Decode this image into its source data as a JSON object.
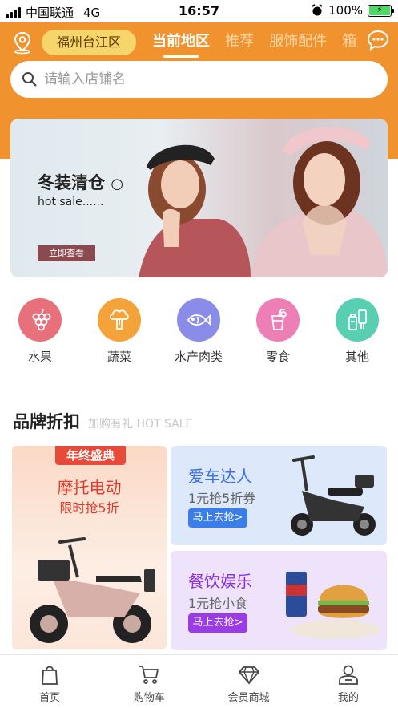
{
  "status_bar": {
    "carrier": "中国联通",
    "network": "4G",
    "time": "16:57",
    "battery": "100%"
  },
  "header": {
    "location": "福州台江区",
    "tabs": [
      {
        "label": "当前地区",
        "active": true
      },
      {
        "label": "推荐",
        "active": false
      },
      {
        "label": "服饰配件",
        "active": false
      },
      {
        "label": "箱包",
        "active": false
      }
    ],
    "accent": "#f0922e"
  },
  "search": {
    "placeholder": "请输入店铺名"
  },
  "banner": {
    "title": "冬装清仓",
    "subtitle": "hot sale......",
    "button": "立即查看"
  },
  "categories": [
    {
      "label": "水果",
      "icon": "grapes-icon",
      "color": "#e8707a"
    },
    {
      "label": "蔬菜",
      "icon": "broccoli-icon",
      "color": "#f4a23a"
    },
    {
      "label": "水产肉类",
      "icon": "fish-icon",
      "color": "#8a8ce8"
    },
    {
      "label": "零食",
      "icon": "drink-icon",
      "color": "#ee7fb6"
    },
    {
      "label": "其他",
      "icon": "bottles-icon",
      "color": "#58cfb1"
    }
  ],
  "brand": {
    "title": "品牌折扣",
    "subtitle": "加购有礼 HOT SALE",
    "left_card": {
      "badge": "年终盛典",
      "title": "摩托电动",
      "subtitle": "限时抢5折"
    },
    "right_cards": [
      {
        "title": "爱车达人",
        "subtitle": "1元抢5折券",
        "button": "马上去抢>"
      },
      {
        "title": "餐饮娱乐",
        "subtitle": "1元抢小食",
        "button": "马上去抢>"
      }
    ]
  },
  "bottom_nav": [
    {
      "label": "首页",
      "icon": "shopping-bag-icon"
    },
    {
      "label": "购物车",
      "icon": "cart-icon"
    },
    {
      "label": "会员商城",
      "icon": "diamond-icon"
    },
    {
      "label": "我的",
      "icon": "user-icon"
    }
  ]
}
